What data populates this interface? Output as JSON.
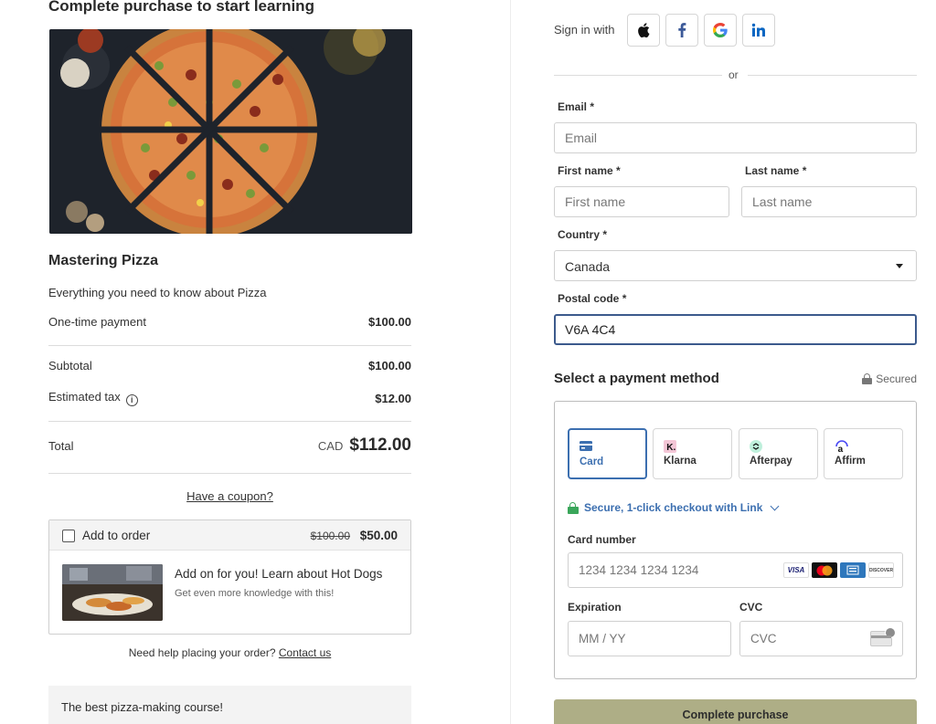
{
  "left": {
    "title": "Complete purchase to start learning",
    "course": {
      "title": "Mastering Pizza",
      "description": "Everything you need to know about Pizza"
    },
    "summary": {
      "one_time_label": "One-time payment",
      "one_time_value": "$100.00",
      "subtotal_label": "Subtotal",
      "subtotal_value": "$100.00",
      "tax_label": "Estimated tax",
      "tax_value": "$12.00",
      "total_label": "Total",
      "total_currency": "CAD",
      "total_value": "$112.00"
    },
    "coupon_label": "Have a coupon?",
    "addon": {
      "checkbox_label": "Add to order",
      "old_price": "$100.00",
      "new_price": "$50.00",
      "title": "Add on for you! Learn about Hot Dogs",
      "subtitle": "Get even more knowledge with this!",
      "checked": false
    },
    "help": {
      "text": "Need help placing your order?",
      "link": "Contact us"
    },
    "testimonial": "The best pizza-making course!"
  },
  "right": {
    "signin": {
      "label": "Sign in with",
      "providers": [
        "apple-icon",
        "facebook-icon",
        "google-icon",
        "linkedin-icon"
      ]
    },
    "or_text": "or",
    "email": {
      "label": "Email *",
      "placeholder": "Email",
      "value": ""
    },
    "first_name": {
      "label": "First name *",
      "placeholder": "First name",
      "value": ""
    },
    "last_name": {
      "label": "Last name *",
      "placeholder": "Last name",
      "value": ""
    },
    "country": {
      "label": "Country *",
      "value": "Canada"
    },
    "postal": {
      "label": "Postal code *",
      "value": "V6A 4C4"
    },
    "payment": {
      "title": "Select a payment method",
      "secured": "Secured",
      "tabs": [
        {
          "label": "Card",
          "icon": "card-icon",
          "active": true
        },
        {
          "label": "Klarna",
          "icon": "klarna-icon",
          "active": false
        },
        {
          "label": "Afterpay",
          "icon": "afterpay-icon",
          "active": false
        },
        {
          "label": "Affirm",
          "icon": "affirm-icon",
          "active": false
        }
      ],
      "link_text": "Secure, 1-click checkout with Link",
      "card_number": {
        "label": "Card number",
        "placeholder": "1234 1234 1234 1234"
      },
      "brands": [
        "VISA",
        "",
        "",
        "DISCOVER"
      ],
      "expiration": {
        "label": "Expiration",
        "placeholder": "MM / YY"
      },
      "cvc": {
        "label": "CVC",
        "placeholder": "CVC"
      }
    },
    "submit_label": "Complete purchase"
  },
  "colors": {
    "accent_blue": "#3c6fb0",
    "focus_border": "#3c5a8c",
    "link_green": "#3aa65a",
    "submit_bg": "#aeae86"
  }
}
